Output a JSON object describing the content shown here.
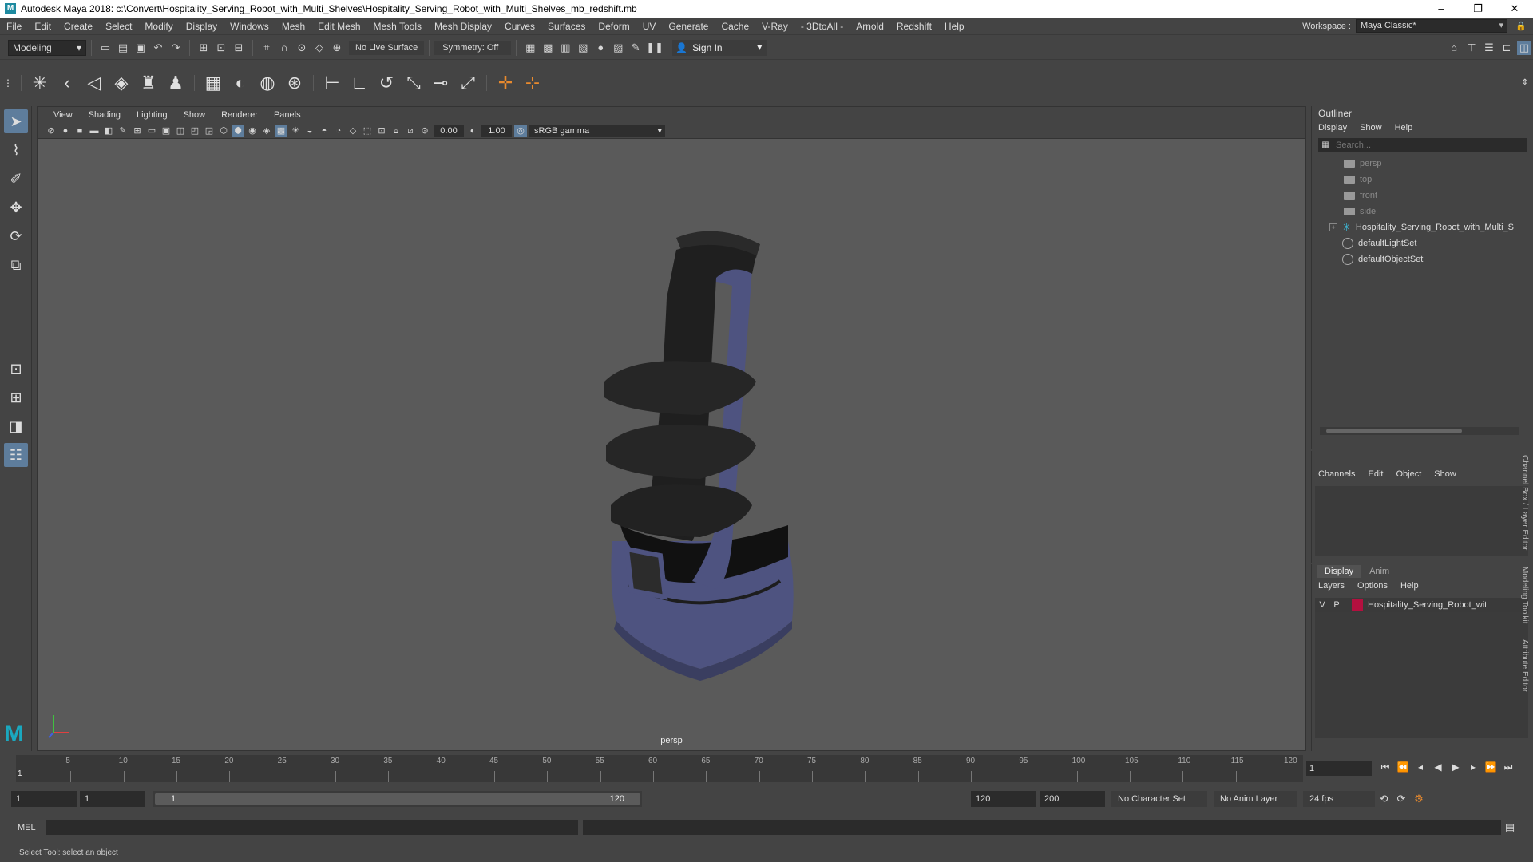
{
  "titlebar": {
    "title": "Autodesk Maya 2018: c:\\Convert\\Hospitality_Serving_Robot_with_Multi_Shelves\\Hospitality_Serving_Robot_with_Multi_Shelves_mb_redshift.mb",
    "minimize": "–",
    "maximize": "❐",
    "close": "✕"
  },
  "menubar": {
    "items": [
      "File",
      "Edit",
      "Create",
      "Select",
      "Modify",
      "Display",
      "Windows",
      "Mesh",
      "Edit Mesh",
      "Mesh Tools",
      "Mesh Display",
      "Curves",
      "Surfaces",
      "Deform",
      "UV",
      "Generate",
      "Cache",
      "V-Ray",
      "- 3DtoAll -",
      "Arnold",
      "Redshift",
      "Help"
    ],
    "workspace_label": "Workspace :",
    "workspace_value": "Maya Classic*"
  },
  "statusline": {
    "mode": "Modeling",
    "live_surface": "No Live Surface",
    "symmetry": "Symmetry: Off",
    "sign_in": "Sign In"
  },
  "viewport": {
    "menu": [
      "View",
      "Shading",
      "Lighting",
      "Show",
      "Renderer",
      "Panels"
    ],
    "exposure": "0.00",
    "gamma": "1.00",
    "color_space": "sRGB gamma",
    "camera_label": "persp"
  },
  "outliner": {
    "title": "Outliner",
    "menu": [
      "Display",
      "Show",
      "Help"
    ],
    "search_placeholder": "Search...",
    "cameras": [
      "persp",
      "top",
      "front",
      "side"
    ],
    "nodes": [
      "Hospitality_Serving_Robot_with_Multi_S",
      "defaultLightSet",
      "defaultObjectSet"
    ]
  },
  "channelbox": {
    "menu": [
      "Channels",
      "Edit",
      "Object",
      "Show"
    ]
  },
  "layereditor": {
    "tabs": [
      "Display",
      "Anim"
    ],
    "menu": [
      "Layers",
      "Options",
      "Help"
    ],
    "layer": {
      "v": "V",
      "p": "P",
      "name": "Hospitality_Serving_Robot_wit",
      "color": "#b3103f"
    }
  },
  "sidetabs": [
    "Channel Box / Layer Editor",
    "Modeling Toolkit",
    "Attribute Editor"
  ],
  "timeslider": {
    "ticks": [
      "5",
      "10",
      "15",
      "20",
      "25",
      "30",
      "35",
      "40",
      "45",
      "50",
      "55",
      "60",
      "65",
      "70",
      "75",
      "80",
      "85",
      "90",
      "95",
      "100",
      "105",
      "110",
      "115",
      "120"
    ],
    "start_marker": "1",
    "current_frame": "1"
  },
  "rangeslider": {
    "start": "1",
    "anim_start": "1",
    "range_lo": "1",
    "range_hi": "120",
    "anim_end": "120",
    "end": "200",
    "character_set": "No Character Set",
    "anim_layer": "No Anim Layer",
    "fps": "24 fps"
  },
  "cmdline": {
    "label": "MEL"
  },
  "helpline": {
    "text": "Select Tool: select an object"
  },
  "colors": {
    "accent": "#5e7d9c",
    "maya_logo": "#1aa8bf",
    "robot_body": "#4e5380",
    "robot_shelf": "#262626"
  }
}
